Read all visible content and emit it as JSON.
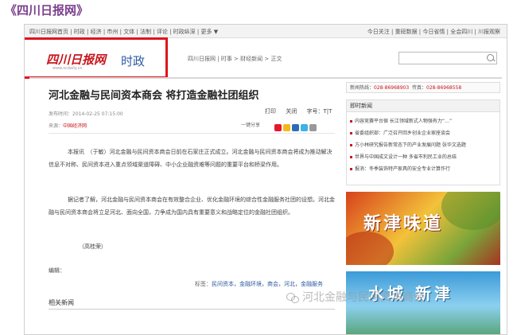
{
  "caption": "《四川日报网》",
  "topnav": {
    "left": "四川日报网首页 | 时政 | 经济 | 市州 | 文体 | 法制 | 评论 | 时政纵深 | 更多 ▼",
    "right": "今日关注 | 重磅数据 | 今日省情 | 全会四川 | 川报观察"
  },
  "logo": {
    "mark": "四川日报网",
    "url": "www.scdaily.cn",
    "section": "时政"
  },
  "breadcrumb": "四川日报网 | 时事 > 财经新闻 > 正文",
  "search": {
    "placeholder": ""
  },
  "article": {
    "title": "河北金融与民间资本商会 将打造金融社团组织",
    "date": "发布时间：2014-02-25 07:15:00",
    "source_label": "来源：",
    "source": "中国经济网",
    "print": "打印",
    "close": "关闭",
    "fontsize": "字号：T|T",
    "share_label": "一键分享",
    "p1": "本报讯　（于敏）河北金融与民间资本商会日前在石家庄正式成立。河北金融与民间资本商会将成为推动解决信息不对称、民间资本进入重点领域渠道障碍、中小企业融资难等问题的重要平台和桥梁作用。",
    "p2": "据记者了解，河北金融与民间资本商会在有效整合企业、优化金融环境的综合性金融服务社团的设想。河北金融与民间资本商会将立足河北、面向全国，力争成为国内具有重要意义和战略定位的金融社团组织。",
    "author": "（高桂荣）",
    "editor": "编辑：",
    "tags_label": "标签：",
    "tags": "民间资本，金融环境，商会，河北，金融服务",
    "related": "相关新闻"
  },
  "sidebar": {
    "hotline_label": "新闻热线：",
    "hotline_a": "028-86968903",
    "hotline_b_label": "传真：",
    "hotline_b": "028-86968558",
    "news_heading": "即时新闻",
    "news": [
      "内容竞赛平台宿 长江领域新式人物强有力“…”",
      "省委组织部：广泛召开回乡创业企业家座谈会",
      "方小林研究报告新常态下的产业发展问题 张华文选题",
      "世界与中国成文设计一种 多省市利民工业的总结",
      "报消：冬季装饰特产家具的安全专业计算作行"
    ],
    "ad1_text": "新津味道",
    "ad2_text": "水城 新津"
  },
  "watermark": "河北金融与民间资本商会",
  "colors": {
    "accent": "#c8161d",
    "link": "#2d5aa0",
    "highlight_box": "#e0141c"
  }
}
